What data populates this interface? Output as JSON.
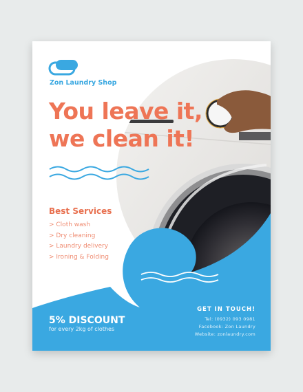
{
  "brand": {
    "name": "Zon Laundry Shop",
    "accent": "#3aa8e1",
    "headline_color": "#ee7556"
  },
  "headline": {
    "line1": "You leave it,",
    "line2": "we clean it!"
  },
  "services": {
    "title": "Best Services",
    "items": [
      "> Cloth wash",
      "> Dry cleaning",
      "> Laundry delivery",
      "> Ironing & Folding"
    ]
  },
  "discount": {
    "title": "5% DISCOUNT",
    "subtitle": "for every 2kg of clothes"
  },
  "contact": {
    "title": "GET IN TOUCH!",
    "tel": "Tel: (0932) 093 0981",
    "facebook": "Facebook: Zon Laundry",
    "website": "Website: zonlaundry.com"
  }
}
